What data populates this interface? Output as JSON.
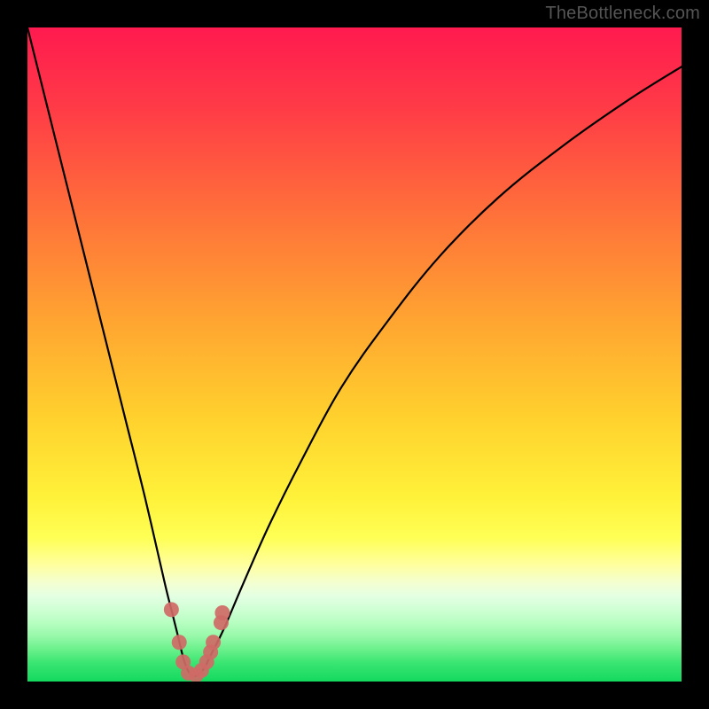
{
  "watermark": "TheBottleneck.com",
  "chart_data": {
    "type": "line",
    "title": "",
    "xlabel": "",
    "ylabel": "",
    "x_range": [
      0,
      100
    ],
    "y_range": [
      0,
      100
    ],
    "series": [
      {
        "name": "bottleneck-curve",
        "color": "#000000",
        "x": [
          0,
          3,
          6,
          9,
          12,
          15,
          18,
          21,
          22,
          23,
          24,
          25,
          26,
          27,
          28,
          30,
          33,
          37,
          42,
          48,
          55,
          63,
          72,
          82,
          92,
          100
        ],
        "y": [
          100,
          88,
          76,
          64,
          52,
          40,
          28,
          15,
          11,
          7,
          3,
          1,
          1,
          2,
          4,
          8,
          15,
          24,
          34,
          45,
          55,
          65,
          74,
          82,
          89,
          94
        ]
      }
    ],
    "markers": {
      "name": "highlight-points",
      "color": "#cf6a66",
      "points": [
        {
          "x": 22.0,
          "y": 11.0
        },
        {
          "x": 23.2,
          "y": 6.0
        },
        {
          "x": 23.8,
          "y": 3.0
        },
        {
          "x": 24.6,
          "y": 1.3
        },
        {
          "x": 25.8,
          "y": 1.0
        },
        {
          "x": 26.6,
          "y": 1.7
        },
        {
          "x": 27.4,
          "y": 3.0
        },
        {
          "x": 28.0,
          "y": 4.5
        },
        {
          "x": 28.4,
          "y": 6.0
        },
        {
          "x": 29.6,
          "y": 9.0
        },
        {
          "x": 29.8,
          "y": 10.5
        }
      ]
    },
    "gradient_stops": [
      {
        "offset": 0.0,
        "color": "#ff1a4f"
      },
      {
        "offset": 0.12,
        "color": "#ff3a47"
      },
      {
        "offset": 0.28,
        "color": "#ff6f3a"
      },
      {
        "offset": 0.45,
        "color": "#ffa531"
      },
      {
        "offset": 0.6,
        "color": "#ffd22d"
      },
      {
        "offset": 0.72,
        "color": "#fff23a"
      },
      {
        "offset": 0.78,
        "color": "#ffff55"
      },
      {
        "offset": 0.82,
        "color": "#ffff9c"
      },
      {
        "offset": 0.85,
        "color": "#f3ffd2"
      },
      {
        "offset": 0.87,
        "color": "#e3ffe3"
      },
      {
        "offset": 0.89,
        "color": "#cfffd4"
      },
      {
        "offset": 0.91,
        "color": "#b7fec1"
      },
      {
        "offset": 0.93,
        "color": "#98f9aa"
      },
      {
        "offset": 0.95,
        "color": "#6cf18d"
      },
      {
        "offset": 0.97,
        "color": "#3de673"
      },
      {
        "offset": 1.0,
        "color": "#13d95f"
      }
    ]
  }
}
